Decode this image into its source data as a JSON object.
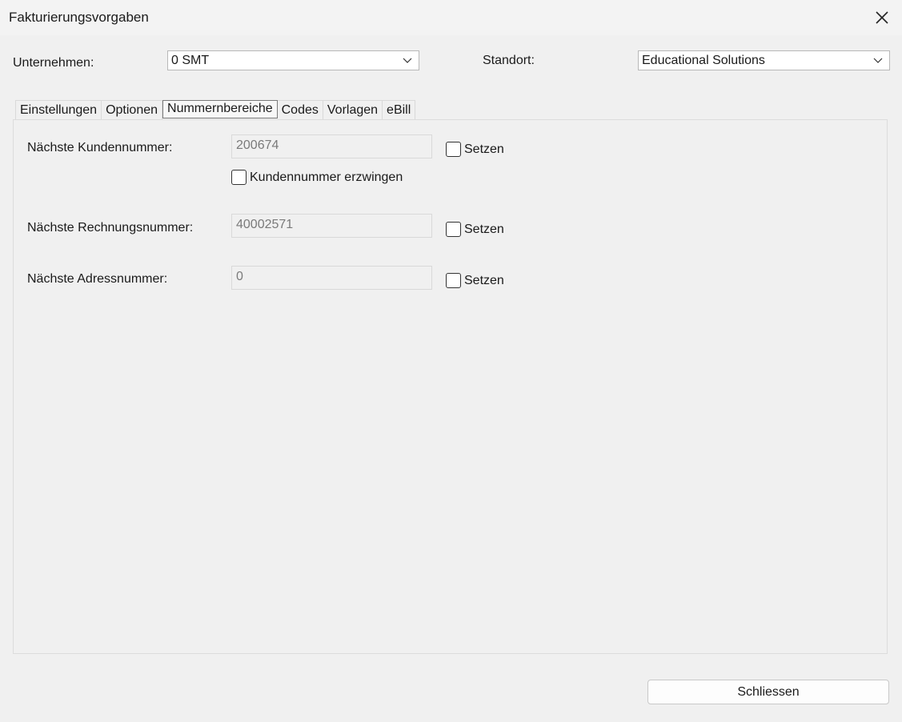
{
  "window": {
    "title": "Fakturierungsvorgaben"
  },
  "header": {
    "company_label": "Unternehmen:",
    "company_value": "0 SMT",
    "location_label": "Standort:",
    "location_value": "Educational Solutions"
  },
  "tabs": [
    {
      "label": "Einstellungen"
    },
    {
      "label": "Optionen"
    },
    {
      "label": "Nummernbereiche",
      "active": true
    },
    {
      "label": "Codes"
    },
    {
      "label": "Vorlagen"
    },
    {
      "label": "eBill"
    }
  ],
  "form": {
    "customer_label": "Nächste Kundennummer:",
    "customer_value": "200674",
    "customer_set_label": "Setzen",
    "enforce_label": "Kundennummer erzwingen",
    "invoice_label": "Nächste Rechnungsnummer:",
    "invoice_value": "40002571",
    "invoice_set_label": "Setzen",
    "address_label": "Nächste Adressnummer:",
    "address_value": "0",
    "address_set_label": "Setzen"
  },
  "footer": {
    "close_label": "Schliessen"
  },
  "icons": [
    "close-icon",
    "chevron-down-icon"
  ]
}
